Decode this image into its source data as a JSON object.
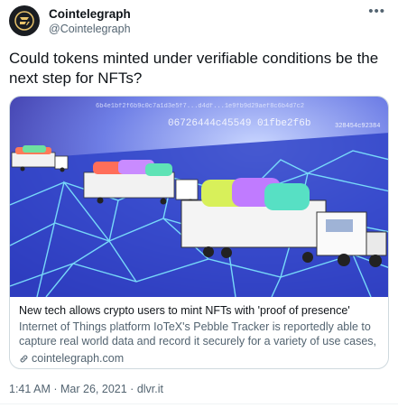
{
  "author": {
    "name": "Cointelegraph",
    "handle": "@Cointelegraph"
  },
  "tweet": {
    "text": "Could tokens minted under verifiable conditions be the next step for NFTs?"
  },
  "card": {
    "image_hash_text": "6b4e1bf2f6b9c0c7a1d3e5f7...d4df...1e9fb9d29aef8c6b4d7c2",
    "image_hash_text_2": "06726444c45549 01fbe2f6b",
    "image_hash_text_3": "328454c92384",
    "title": "New tech allows crypto users to mint NFTs with 'proof of presence'",
    "description": "Internet of Things platform IoTeX's Pebble Tracker is reportedly able to capture real world data and record it securely for a variety of use cases, ...",
    "domain": "cointelegraph.com"
  },
  "meta": {
    "time": "1:41 AM",
    "separator": "·",
    "date": "Mar 26, 2021",
    "source": "dlvr.it"
  },
  "colors": {
    "accent": "#1d9bf0",
    "text_secondary": "#536471"
  },
  "icons": {
    "avatar": "cointelegraph-logo",
    "more": "more-icon",
    "link": "link-icon"
  }
}
